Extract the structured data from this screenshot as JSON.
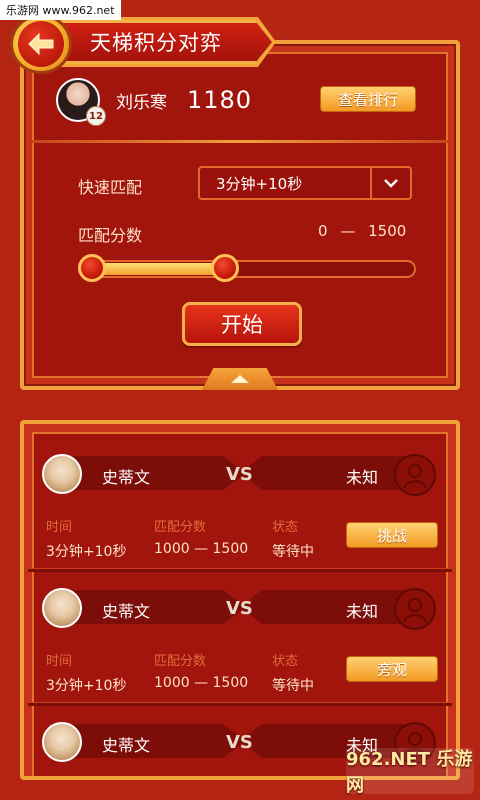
{
  "watermark": {
    "top": "乐游网 www.962.net",
    "bottom": "962.NET 乐游网"
  },
  "header": {
    "title": "天梯积分对弈"
  },
  "user": {
    "name": "刘乐寒",
    "score": "1180",
    "level": "12",
    "ranking_button": "查看排行"
  },
  "matching": {
    "quick_label": "快速匹配",
    "quick_value": "3分钟+10秒",
    "score_label": "匹配分数",
    "score_min": "0",
    "score_sep": "—",
    "score_max": "1500",
    "slider_low_fraction": 0.0,
    "slider_high_fraction": 0.4,
    "start_button": "开始"
  },
  "matches": [
    {
      "left_name": "史蒂文",
      "vs": "VS",
      "right_name": "未知",
      "time_label": "时间",
      "time_value": "3分钟+10秒",
      "score_label": "匹配分数",
      "score_value": "1000 — 1500",
      "status_label": "状态",
      "status_value": "等待中",
      "action": "挑战"
    },
    {
      "left_name": "史蒂文",
      "vs": "VS",
      "right_name": "未知",
      "time_label": "时间",
      "time_value": "3分钟+10秒",
      "score_label": "匹配分数",
      "score_value": "1000 — 1500",
      "status_label": "状态",
      "status_value": "等待中",
      "action": "旁观"
    },
    {
      "left_name": "史蒂文",
      "vs": "VS",
      "right_name": "未知"
    }
  ],
  "icons": {
    "back": "back-arrow-icon",
    "dropdown": "chevron-down-icon",
    "collapse": "chevron-up-icon",
    "unknown_user": "user-silhouette-icon"
  },
  "colors": {
    "background": "#b52514",
    "panel_border": "#f2a03a",
    "button": "#f29a24"
  }
}
